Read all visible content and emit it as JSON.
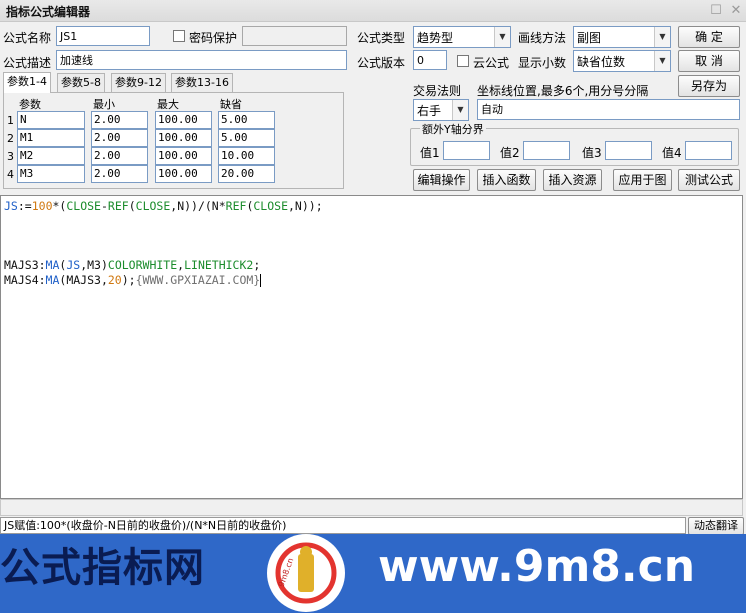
{
  "window": {
    "title": "指标公式编辑器",
    "restore_glyph": "☐",
    "close_glyph": "✕"
  },
  "header": {
    "name_label": "公式名称",
    "name_value": "JS1",
    "password_label": "密码保护",
    "desc_label": "公式描述",
    "desc_value": "加速线",
    "type_label": "公式类型",
    "type_value": "趋势型",
    "version_label": "公式版本",
    "version_value": "0",
    "cloud_label": "云公式",
    "draw_label": "画线方法",
    "draw_value": "副图",
    "decimal_label": "显示小数",
    "decimal_value": "缺省位数"
  },
  "buttons": {
    "ok": "确  定",
    "cancel": "取  消",
    "save_as": "另存为"
  },
  "tabs": [
    "参数1-4",
    "参数5-8",
    "参数9-12",
    "参数13-16"
  ],
  "params": {
    "headers": [
      "参数",
      "最小",
      "最大",
      "缺省"
    ],
    "rows": [
      {
        "idx": "1",
        "name": "N",
        "min": "2.00",
        "max": "100.00",
        "def": "5.00"
      },
      {
        "idx": "2",
        "name": "M1",
        "min": "2.00",
        "max": "100.00",
        "def": "5.00"
      },
      {
        "idx": "3",
        "name": "M2",
        "min": "2.00",
        "max": "100.00",
        "def": "10.00"
      },
      {
        "idx": "4",
        "name": "M3",
        "min": "2.00",
        "max": "100.00",
        "def": "20.00"
      }
    ]
  },
  "trade": {
    "rule_label": "交易法则",
    "rule_value": "右手",
    "coord_label": "坐标线位置,最多6个,用分号分隔",
    "coord_value": "自动"
  },
  "yaxis": {
    "group_label": "额外Y轴分界",
    "v1": "值1",
    "v2": "值2",
    "v3": "值3",
    "v4": "值4"
  },
  "actions": [
    "编辑操作",
    "插入函数",
    "插入资源",
    "应用于图",
    "测试公式"
  ],
  "code": {
    "l1": {
      "a": "JS",
      "b": ":=",
      "c": "100",
      "d": "*(",
      "e": "CLOSE",
      "f": "-",
      "g": "REF",
      "h": "(",
      "i": "CLOSE",
      "j": ",N))/(N*",
      "k": "REF",
      "l": "(",
      "m": "CLOSE",
      "n": ",N));"
    },
    "l2": {
      "a": "MAJS3:",
      "b": "MA",
      "c": "(",
      "d": "JS",
      "e": ",M3)",
      "f": "COLORWHITE",
      "g": ",",
      "h": "LINETHICK2",
      "i": ";"
    },
    "l3": {
      "a": "MAJS4:",
      "b": "MA",
      "c": "(MAJS3,",
      "d": "20",
      "e": ");",
      "f": "{WWW.GPXIAZAI.COM}"
    }
  },
  "status": {
    "text": "JS赋值:100*(收盘价-N日前的收盘价)/(N*N日前的收盘价)",
    "dyn_button": "动态翻译"
  },
  "banner": {
    "left_text": "公式指标网",
    "right_text": "www.9m8.cn",
    "logo_text": "9m8.cn",
    "bg_color": "#2f68c8"
  }
}
